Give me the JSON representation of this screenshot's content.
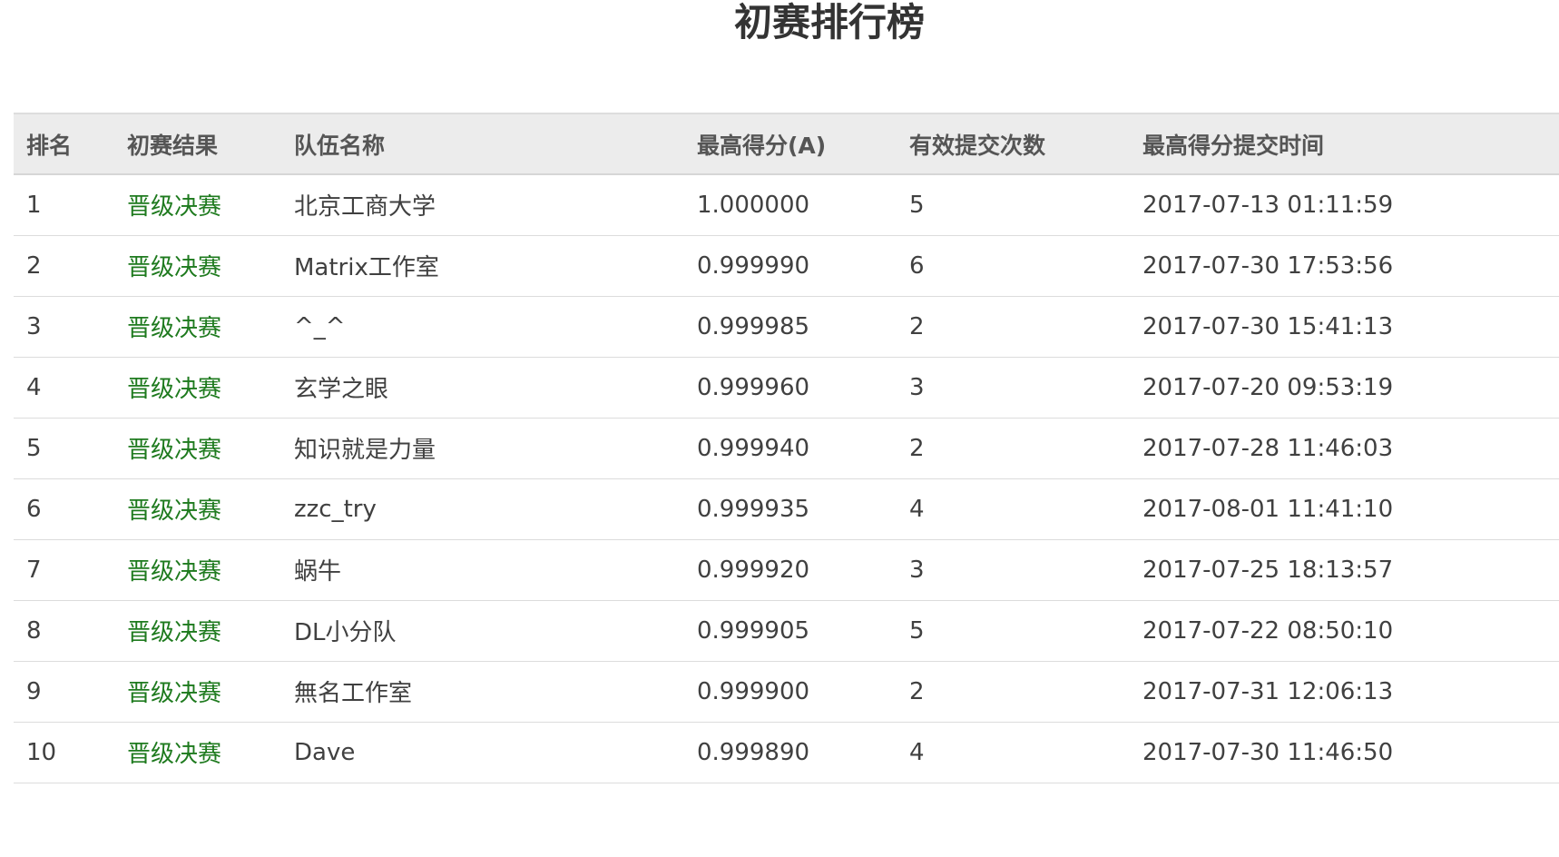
{
  "page": {
    "title": "初赛排行榜"
  },
  "table": {
    "headers": [
      "排名",
      "初赛结果",
      "队伍名称",
      "最高得分(A)",
      "有效提交次数",
      "最高得分提交时间"
    ],
    "rows": [
      {
        "rank": "1",
        "result": "晋级决赛",
        "team": "北京工商大学",
        "score": "1.000000",
        "submissions": "5",
        "time": "2017-07-13 01:11:59"
      },
      {
        "rank": "2",
        "result": "晋级决赛",
        "team": "Matrix工作室",
        "score": "0.999990",
        "submissions": "6",
        "time": "2017-07-30 17:53:56"
      },
      {
        "rank": "3",
        "result": "晋级决赛",
        "team": "^_^",
        "score": "0.999985",
        "submissions": "2",
        "time": "2017-07-30 15:41:13"
      },
      {
        "rank": "4",
        "result": "晋级决赛",
        "team": "玄学之眼",
        "score": "0.999960",
        "submissions": "3",
        "time": "2017-07-20 09:53:19"
      },
      {
        "rank": "5",
        "result": "晋级决赛",
        "team": "知识就是力量",
        "score": "0.999940",
        "submissions": "2",
        "time": "2017-07-28 11:46:03"
      },
      {
        "rank": "6",
        "result": "晋级决赛",
        "team": "zzc_try",
        "score": "0.999935",
        "submissions": "4",
        "time": "2017-08-01 11:41:10"
      },
      {
        "rank": "7",
        "result": "晋级决赛",
        "team": "蜗牛",
        "score": "0.999920",
        "submissions": "3",
        "time": "2017-07-25 18:13:57"
      },
      {
        "rank": "8",
        "result": "晋级决赛",
        "team": "DL小分队",
        "score": "0.999905",
        "submissions": "5",
        "time": "2017-07-22 08:50:10"
      },
      {
        "rank": "9",
        "result": "晋级决赛",
        "team": "無名工作室",
        "score": "0.999900",
        "submissions": "2",
        "time": "2017-07-31 12:06:13"
      },
      {
        "rank": "10",
        "result": "晋级决赛",
        "team": "Dave",
        "score": "0.999890",
        "submissions": "4",
        "time": "2017-07-30 11:46:50"
      }
    ]
  },
  "colors": {
    "header_bg": "#ececec",
    "result_text": "#1e7a1e",
    "body_text": "#404040",
    "row_border": "#dcdcdc"
  }
}
